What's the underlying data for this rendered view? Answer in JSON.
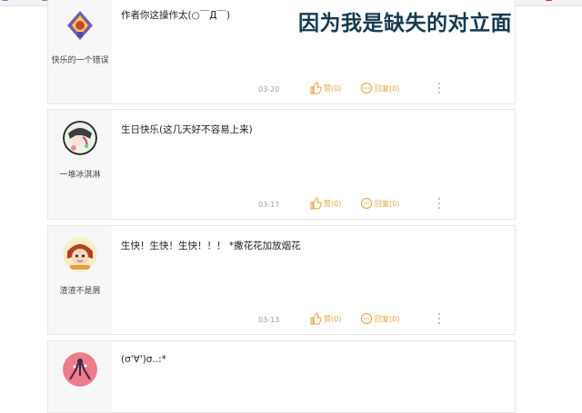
{
  "comments": [
    {
      "username": "快乐的一个错误",
      "text": "作者你这操作太(○￣Д￣)",
      "date": "03-20",
      "like_label": "赞(0)",
      "reply_label": "回复(0)"
    },
    {
      "username": "一堆冰淇淋",
      "text": "生日快乐(这几天好不容易上来)",
      "date": "03-17",
      "like_label": "赞(0)",
      "reply_label": "回复(0)"
    },
    {
      "username": "渣渣不是屑",
      "text": "生快！生快！生快！！！ *撒花花加放烟花",
      "date": "03-13",
      "like_label": "赞(0)",
      "reply_label": "回复(0)"
    },
    {
      "username": "",
      "text": "(σ'∀')σ..:*",
      "date": "",
      "like_label": "",
      "reply_label": ""
    }
  ],
  "watermark": "因为我是缺失的对立面",
  "colors": {
    "accent": "#e0a33a",
    "watermark": "#163a4f",
    "card_border": "#e6e6e6",
    "sidebar_bg": "#f7f7f7"
  },
  "icons": {
    "like": "thumbs-up-icon",
    "reply": "speech-bubble-icon",
    "more": "vertical-dots-icon"
  }
}
